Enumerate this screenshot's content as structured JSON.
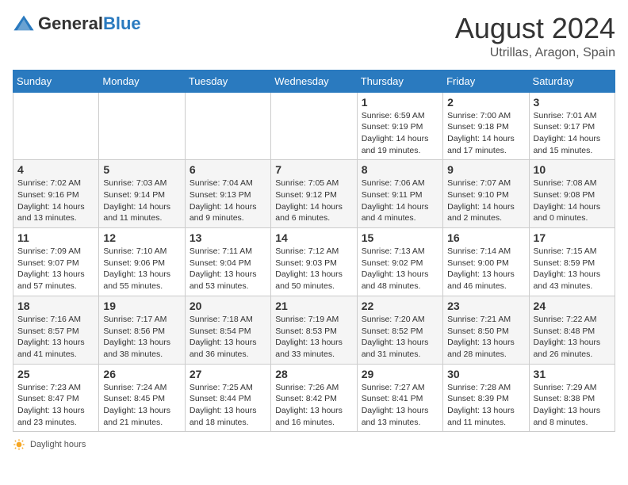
{
  "header": {
    "logo_general": "General",
    "logo_blue": "Blue",
    "title": "August 2024",
    "location": "Utrillas, Aragon, Spain"
  },
  "days_of_week": [
    "Sunday",
    "Monday",
    "Tuesday",
    "Wednesday",
    "Thursday",
    "Friday",
    "Saturday"
  ],
  "weeks": [
    [
      {
        "day": "",
        "info": ""
      },
      {
        "day": "",
        "info": ""
      },
      {
        "day": "",
        "info": ""
      },
      {
        "day": "",
        "info": ""
      },
      {
        "day": "1",
        "info": "Sunrise: 6:59 AM\nSunset: 9:19 PM\nDaylight: 14 hours\nand 19 minutes."
      },
      {
        "day": "2",
        "info": "Sunrise: 7:00 AM\nSunset: 9:18 PM\nDaylight: 14 hours\nand 17 minutes."
      },
      {
        "day": "3",
        "info": "Sunrise: 7:01 AM\nSunset: 9:17 PM\nDaylight: 14 hours\nand 15 minutes."
      }
    ],
    [
      {
        "day": "4",
        "info": "Sunrise: 7:02 AM\nSunset: 9:16 PM\nDaylight: 14 hours\nand 13 minutes."
      },
      {
        "day": "5",
        "info": "Sunrise: 7:03 AM\nSunset: 9:14 PM\nDaylight: 14 hours\nand 11 minutes."
      },
      {
        "day": "6",
        "info": "Sunrise: 7:04 AM\nSunset: 9:13 PM\nDaylight: 14 hours\nand 9 minutes."
      },
      {
        "day": "7",
        "info": "Sunrise: 7:05 AM\nSunset: 9:12 PM\nDaylight: 14 hours\nand 6 minutes."
      },
      {
        "day": "8",
        "info": "Sunrise: 7:06 AM\nSunset: 9:11 PM\nDaylight: 14 hours\nand 4 minutes."
      },
      {
        "day": "9",
        "info": "Sunrise: 7:07 AM\nSunset: 9:10 PM\nDaylight: 14 hours\nand 2 minutes."
      },
      {
        "day": "10",
        "info": "Sunrise: 7:08 AM\nSunset: 9:08 PM\nDaylight: 14 hours\nand 0 minutes."
      }
    ],
    [
      {
        "day": "11",
        "info": "Sunrise: 7:09 AM\nSunset: 9:07 PM\nDaylight: 13 hours\nand 57 minutes."
      },
      {
        "day": "12",
        "info": "Sunrise: 7:10 AM\nSunset: 9:06 PM\nDaylight: 13 hours\nand 55 minutes."
      },
      {
        "day": "13",
        "info": "Sunrise: 7:11 AM\nSunset: 9:04 PM\nDaylight: 13 hours\nand 53 minutes."
      },
      {
        "day": "14",
        "info": "Sunrise: 7:12 AM\nSunset: 9:03 PM\nDaylight: 13 hours\nand 50 minutes."
      },
      {
        "day": "15",
        "info": "Sunrise: 7:13 AM\nSunset: 9:02 PM\nDaylight: 13 hours\nand 48 minutes."
      },
      {
        "day": "16",
        "info": "Sunrise: 7:14 AM\nSunset: 9:00 PM\nDaylight: 13 hours\nand 46 minutes."
      },
      {
        "day": "17",
        "info": "Sunrise: 7:15 AM\nSunset: 8:59 PM\nDaylight: 13 hours\nand 43 minutes."
      }
    ],
    [
      {
        "day": "18",
        "info": "Sunrise: 7:16 AM\nSunset: 8:57 PM\nDaylight: 13 hours\nand 41 minutes."
      },
      {
        "day": "19",
        "info": "Sunrise: 7:17 AM\nSunset: 8:56 PM\nDaylight: 13 hours\nand 38 minutes."
      },
      {
        "day": "20",
        "info": "Sunrise: 7:18 AM\nSunset: 8:54 PM\nDaylight: 13 hours\nand 36 minutes."
      },
      {
        "day": "21",
        "info": "Sunrise: 7:19 AM\nSunset: 8:53 PM\nDaylight: 13 hours\nand 33 minutes."
      },
      {
        "day": "22",
        "info": "Sunrise: 7:20 AM\nSunset: 8:52 PM\nDaylight: 13 hours\nand 31 minutes."
      },
      {
        "day": "23",
        "info": "Sunrise: 7:21 AM\nSunset: 8:50 PM\nDaylight: 13 hours\nand 28 minutes."
      },
      {
        "day": "24",
        "info": "Sunrise: 7:22 AM\nSunset: 8:48 PM\nDaylight: 13 hours\nand 26 minutes."
      }
    ],
    [
      {
        "day": "25",
        "info": "Sunrise: 7:23 AM\nSunset: 8:47 PM\nDaylight: 13 hours\nand 23 minutes."
      },
      {
        "day": "26",
        "info": "Sunrise: 7:24 AM\nSunset: 8:45 PM\nDaylight: 13 hours\nand 21 minutes."
      },
      {
        "day": "27",
        "info": "Sunrise: 7:25 AM\nSunset: 8:44 PM\nDaylight: 13 hours\nand 18 minutes."
      },
      {
        "day": "28",
        "info": "Sunrise: 7:26 AM\nSunset: 8:42 PM\nDaylight: 13 hours\nand 16 minutes."
      },
      {
        "day": "29",
        "info": "Sunrise: 7:27 AM\nSunset: 8:41 PM\nDaylight: 13 hours\nand 13 minutes."
      },
      {
        "day": "30",
        "info": "Sunrise: 7:28 AM\nSunset: 8:39 PM\nDaylight: 13 hours\nand 11 minutes."
      },
      {
        "day": "31",
        "info": "Sunrise: 7:29 AM\nSunset: 8:38 PM\nDaylight: 13 hours\nand 8 minutes."
      }
    ]
  ],
  "footer": {
    "label": "Daylight hours"
  }
}
